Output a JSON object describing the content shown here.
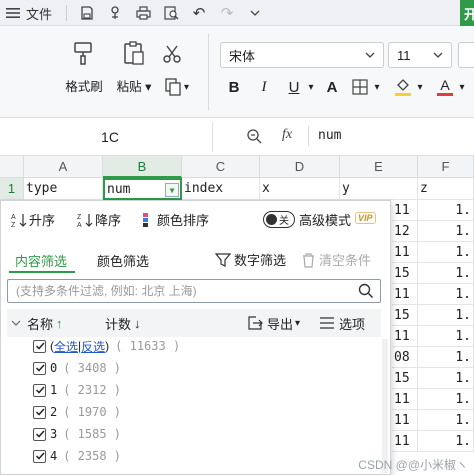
{
  "titlebar": {
    "file_label": "文件",
    "brand_char": "开"
  },
  "ribbon": {
    "format_painter": "格式刷",
    "paste": "粘贴",
    "font_name": "宋体",
    "font_size": "11"
  },
  "formula_bar": {
    "cell_ref": "1C",
    "fx": "fx",
    "value": "num"
  },
  "grid": {
    "columns": [
      "A",
      "B",
      "C",
      "D",
      "E",
      "F"
    ],
    "row1_num": "1",
    "row1": [
      "type",
      "num",
      "index",
      "x",
      "y",
      "z"
    ],
    "right_d": [
      "11",
      "12",
      "11",
      "15",
      "11",
      "15",
      "11",
      "08",
      "15",
      "11",
      "11",
      "11"
    ],
    "right_f": [
      "1.",
      "1.",
      "1.",
      "1.",
      "1.",
      "1.",
      "1.",
      "1.",
      "1.",
      "1.",
      "1.",
      "1."
    ]
  },
  "filter_panel": {
    "sort_asc": "升序",
    "sort_desc": "降序",
    "color_sort": "颜色排序",
    "toggle_text": "关",
    "advanced_mode": "高级模式",
    "vip": "VIP",
    "tab_content": "内容筛选",
    "tab_color": "颜色筛选",
    "number_filter": "数字筛选",
    "clear_conditions": "清空条件",
    "search_placeholder": "(支持多条件过滤, 例如: 北京 上海)",
    "col_name": "名称",
    "col_count": "计数",
    "export": "导出",
    "options": "选项",
    "select_all": "全选",
    "invert": "反选",
    "total_count": "( 11633 )",
    "items": [
      {
        "label": "0",
        "count": "( 3408 )"
      },
      {
        "label": "1",
        "count": "( 2312 )"
      },
      {
        "label": "2",
        "count": "( 1970 )"
      },
      {
        "label": "3",
        "count": "( 1585 )"
      },
      {
        "label": "4",
        "count": "( 2358 )"
      }
    ]
  },
  "watermark": "CSDN @@小米椒ヽ",
  "colors": {
    "accent": "#2f9a47",
    "link": "#2357c5",
    "font_color_bar": "#e23b3b",
    "fill_color_bar": "#f6d12e"
  }
}
